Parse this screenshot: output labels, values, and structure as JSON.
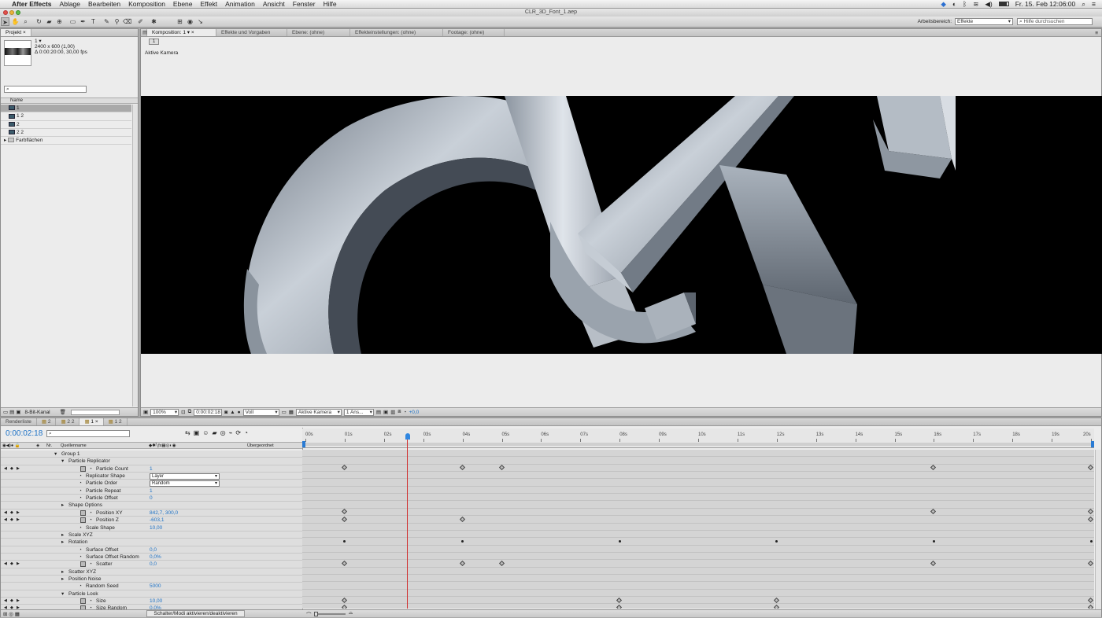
{
  "menubar": {
    "apple": "",
    "items": [
      "After Effects",
      "Ablage",
      "Bearbeiten",
      "Komposition",
      "Ebene",
      "Effekt",
      "Animation",
      "Ansicht",
      "Fenster",
      "Hilfe"
    ],
    "clock": "Fr. 15. Feb  12:06:00"
  },
  "window": {
    "title": "CLR_3D_Font_1.aep"
  },
  "toolbar": {
    "workspace_label": "Arbeitsbereich:",
    "workspace_value": "Effekte",
    "help_placeholder": "Hilfe durchsuchen"
  },
  "project": {
    "tab": "Projekt",
    "comp_name": "1 ▾",
    "comp_info_1": "2400 x 600 (1,00)",
    "comp_info_2": "Δ 0:00:20:00, 30,00 fps",
    "column_name": "Name",
    "items": [
      {
        "label": "1",
        "icon": "composition-icon",
        "selected": true
      },
      {
        "label": "1 2",
        "icon": "composition-icon",
        "selected": false
      },
      {
        "label": "2",
        "icon": "composition-icon",
        "selected": false
      },
      {
        "label": "2 2",
        "icon": "composition-icon",
        "selected": false
      },
      {
        "label": "Farbflächen",
        "icon": "folder-icon",
        "selected": false
      }
    ],
    "bit_depth": "8-Bit-Kanal"
  },
  "viewer": {
    "tabs": [
      "Komposition: 1",
      "Effekte und Vorgaben",
      "Ebene: (ohne)",
      "Effekteinstellungen: (ohne)",
      "Footage: (ohne)"
    ],
    "comp_chip": "1",
    "camera_label": "Aktive Kamera",
    "zoom": "100%",
    "timecode": "0:00:02:18",
    "resolution": "Voll",
    "camera_select": "Aktive Kamera",
    "views": "1 Ans...",
    "exposure": "+0,0"
  },
  "timeline": {
    "tabs": [
      "Renderliste",
      "2",
      "2 2",
      "1",
      "1 2"
    ],
    "active_tab": "1",
    "current_time": "0:00:02:18",
    "col_nr": "Nr.",
    "col_source": "Quellenname",
    "col_parent": "Übergeordnet",
    "bottom_toggle": "Schalter/Modi aktivieren/deaktivieren",
    "ruler": [
      "00s",
      "01s",
      "02s",
      "03s",
      "04s",
      "05s",
      "06s",
      "07s",
      "08s",
      "09s",
      "10s",
      "11s",
      "12s",
      "13s",
      "14s",
      "15s",
      "16s",
      "17s",
      "18s",
      "19s",
      "20s"
    ],
    "current_seconds": 2.6,
    "rows": [
      {
        "name": "Group 1",
        "indent": 0,
        "twirl": "open",
        "value": "",
        "kind": "group",
        "keys": [],
        "dots": []
      },
      {
        "name": "Particle Replicator",
        "indent": 1,
        "twirl": "open",
        "value": "",
        "kind": "group",
        "keys": [],
        "dots": []
      },
      {
        "name": "Particle Count",
        "indent": 2,
        "stopwatch": "on",
        "value": "1",
        "kind": "value",
        "keys": [
          1,
          4,
          5,
          16,
          20
        ],
        "dots": []
      },
      {
        "name": "Replicator Shape",
        "indent": 2,
        "stopwatch": "off",
        "value": "Layer",
        "kind": "select",
        "keys": [],
        "dots": []
      },
      {
        "name": "Particle Order",
        "indent": 2,
        "stopwatch": "off",
        "value": "Random",
        "kind": "select",
        "keys": [],
        "dots": []
      },
      {
        "name": "Particle Repeat",
        "indent": 2,
        "stopwatch": "off",
        "value": "1",
        "kind": "value",
        "keys": [],
        "dots": []
      },
      {
        "name": "Particle Offset",
        "indent": 2,
        "stopwatch": "off",
        "value": "0",
        "kind": "value",
        "keys": [],
        "dots": []
      },
      {
        "name": "Shape Options",
        "indent": 1,
        "twirl": "closed",
        "value": "",
        "kind": "group",
        "keys": [],
        "dots": []
      },
      {
        "name": "Position XY",
        "indent": 2,
        "stopwatch": "on",
        "value": "842,7, 300,0",
        "kind": "value",
        "keys": [
          1,
          16,
          20
        ],
        "dots": []
      },
      {
        "name": "Position Z",
        "indent": 2,
        "stopwatch": "on",
        "value": "-603,1",
        "kind": "value",
        "keys": [
          1,
          4,
          20
        ],
        "dots": []
      },
      {
        "name": "Scale Shape",
        "indent": 2,
        "stopwatch": "off",
        "value": "10,00",
        "kind": "value",
        "keys": [],
        "dots": []
      },
      {
        "name": "Scale XYZ",
        "indent": 1,
        "twirl": "closed",
        "value": "",
        "kind": "group",
        "keys": [],
        "dots": []
      },
      {
        "name": "Rotation",
        "indent": 1,
        "twirl": "closed",
        "value": "",
        "kind": "group",
        "keys": [],
        "dots": [
          1,
          4,
          8,
          12,
          16,
          20
        ]
      },
      {
        "name": "Surface Offset",
        "indent": 2,
        "stopwatch": "off",
        "value": "0,0",
        "kind": "value",
        "keys": [],
        "dots": []
      },
      {
        "name": "Surface Offset Random",
        "indent": 2,
        "stopwatch": "off",
        "value": "0,0%",
        "kind": "value",
        "keys": [],
        "dots": []
      },
      {
        "name": "Scatter",
        "indent": 2,
        "stopwatch": "on",
        "value": "0,0",
        "kind": "value",
        "keys": [
          1,
          4,
          5,
          16,
          20
        ],
        "dots": []
      },
      {
        "name": "Scatter XYZ",
        "indent": 1,
        "twirl": "closed",
        "value": "",
        "kind": "group",
        "keys": [],
        "dots": []
      },
      {
        "name": "Position Noise",
        "indent": 1,
        "twirl": "closed",
        "value": "",
        "kind": "group",
        "keys": [],
        "dots": []
      },
      {
        "name": "Random Seed",
        "indent": 2,
        "stopwatch": "off",
        "value": "5000",
        "kind": "value",
        "keys": [],
        "dots": []
      },
      {
        "name": "Particle Look",
        "indent": 1,
        "twirl": "open",
        "value": "",
        "kind": "group",
        "keys": [],
        "dots": []
      },
      {
        "name": "Size",
        "indent": 2,
        "stopwatch": "on",
        "value": "10,00",
        "kind": "value",
        "keys": [
          1,
          8,
          12,
          20
        ],
        "dots": []
      },
      {
        "name": "Size Random",
        "indent": 2,
        "stopwatch": "on",
        "value": "0,0%",
        "kind": "value",
        "keys": [
          1,
          8,
          12,
          20
        ],
        "dots": []
      }
    ]
  }
}
